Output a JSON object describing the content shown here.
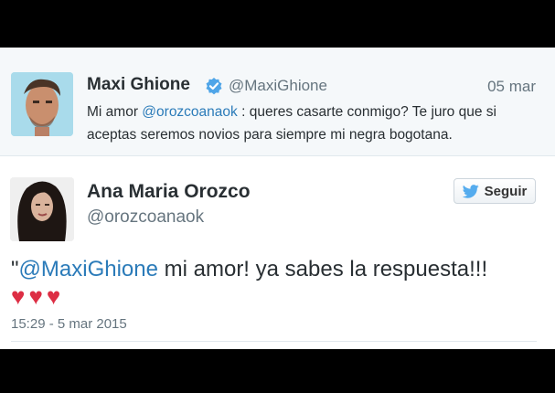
{
  "tweet1": {
    "name": "Maxi Ghione",
    "handle": "@MaxiGhione",
    "date": "05 mar",
    "text_pre": "Mi amor ",
    "mention": "@orozcoanaok",
    "text_post": " : queres casarte conmigo? Te juro que si aceptas seremos novios para siempre mi negra bogotana.",
    "verified_color": "#4fa5e8"
  },
  "tweet2": {
    "name": "Ana Maria Orozco",
    "handle": "@orozcoanaok",
    "follow_label": "Seguir",
    "quote_open": "\"",
    "mention": "@MaxiGhione",
    "text_post": " mi amor! ya sabes la respuesta!!!",
    "hearts": [
      "♥",
      "♥",
      "♥"
    ],
    "timestamp": "15:29 - 5 mar 2015"
  },
  "colors": {
    "link": "#2b7bb9",
    "heart": "#dd2e44",
    "bird": "#55acee"
  },
  "icons": {
    "verified": "verified-badge-icon",
    "bird": "twitter-bird-icon",
    "heart": "heart-icon"
  }
}
